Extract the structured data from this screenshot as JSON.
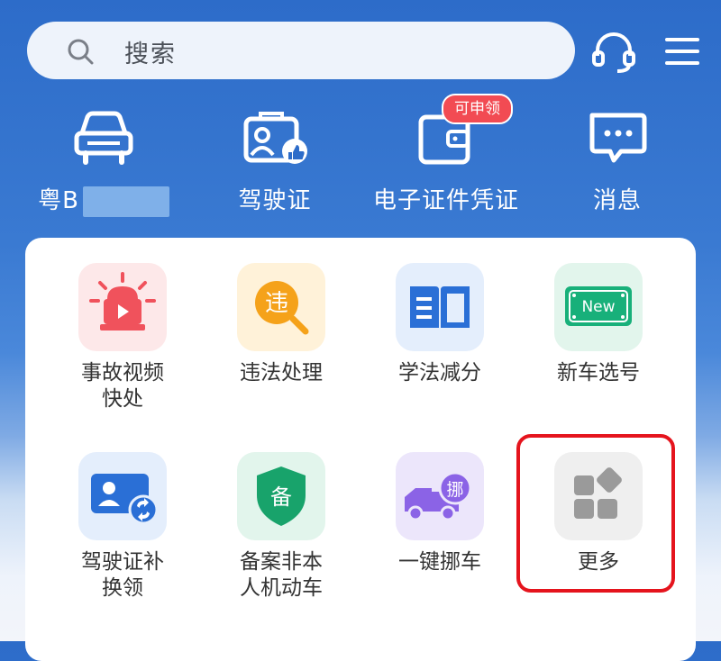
{
  "search": {
    "placeholder": "搜索"
  },
  "quick_actions": [
    {
      "label_prefix": "粤B",
      "icon": "car-icon"
    },
    {
      "label": "驾驶证",
      "icon": "license-icon"
    },
    {
      "label": "电子证件凭证",
      "icon": "wallet-icon",
      "badge": "可申领"
    },
    {
      "label": "消息",
      "icon": "message-icon"
    }
  ],
  "services_row1": [
    {
      "label": "事故视频快处",
      "line1": "事故视频",
      "line2": "快处",
      "icon": "siren-icon",
      "color": "#f0525c"
    },
    {
      "label": "违法处理",
      "icon": "violation-icon",
      "color": "#f5a21a"
    },
    {
      "label": "学法减分",
      "icon": "book-icon",
      "color": "#2a6fd6"
    },
    {
      "label": "新车选号",
      "icon": "new-plate-icon",
      "color": "#18b07a"
    }
  ],
  "services_row2": [
    {
      "label": "驾驶证补换领",
      "line1": "驾驶证补",
      "line2": "换领",
      "icon": "license-swap-icon",
      "color": "#2a6fd6"
    },
    {
      "label": "备案非本人机动车",
      "line1": "备案非本",
      "line2": "人机动车",
      "icon": "shield-icon",
      "glyph": "备",
      "color": "#18a36b"
    },
    {
      "label": "一键挪车",
      "icon": "truck-icon",
      "glyph": "挪",
      "color": "#8b63e6"
    },
    {
      "label": "更多",
      "icon": "more-grid-icon",
      "color": "#9a9a9a"
    }
  ],
  "colors": {
    "brand_blue": "#2d6cc9",
    "highlight_red": "#e5141d"
  }
}
